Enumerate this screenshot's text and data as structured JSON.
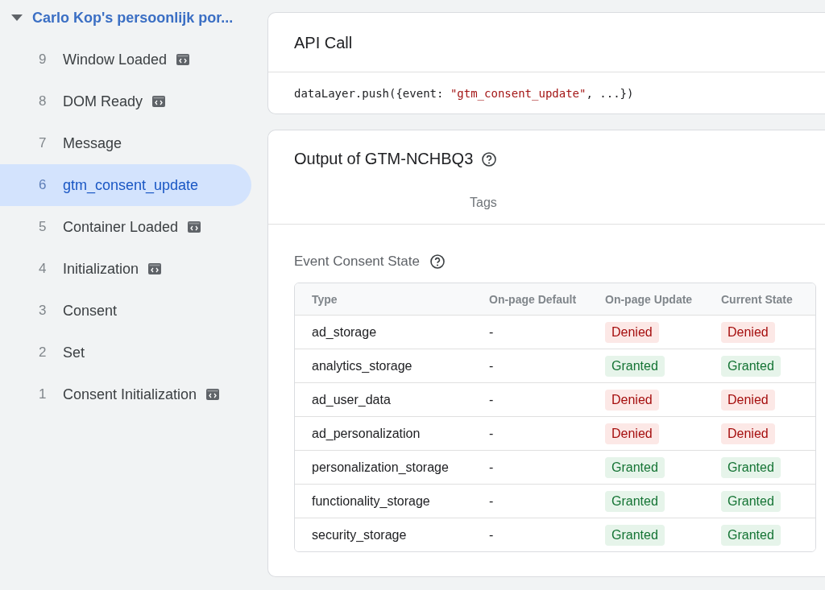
{
  "sidebar": {
    "container": {
      "label": "Carlo Kop's persoonlijk por...",
      "expanded": true
    },
    "items": [
      {
        "number": "9",
        "label": "Window Loaded",
        "has_code_icon": true,
        "selected": false
      },
      {
        "number": "8",
        "label": "DOM Ready",
        "has_code_icon": true,
        "selected": false
      },
      {
        "number": "7",
        "label": "Message",
        "has_code_icon": false,
        "selected": false
      },
      {
        "number": "6",
        "label": "gtm_consent_update",
        "has_code_icon": false,
        "selected": true
      },
      {
        "number": "5",
        "label": "Container Loaded",
        "has_code_icon": true,
        "selected": false
      },
      {
        "number": "4",
        "label": "Initialization",
        "has_code_icon": true,
        "selected": false
      },
      {
        "number": "3",
        "label": "Consent",
        "has_code_icon": false,
        "selected": false
      },
      {
        "number": "2",
        "label": "Set",
        "has_code_icon": false,
        "selected": false
      },
      {
        "number": "1",
        "label": "Consent Initialization",
        "has_code_icon": true,
        "selected": false
      }
    ]
  },
  "api_call": {
    "title": "API Call",
    "code": [
      {
        "kind": "plain",
        "text": "dataLayer.push({event: "
      },
      {
        "kind": "string",
        "text": "\"gtm_consent_update\""
      },
      {
        "kind": "plain",
        "text": ", ...})"
      }
    ]
  },
  "output": {
    "title": "Output of GTM-NCHBQ3",
    "tabs": [
      {
        "label": "Tags",
        "selected": false
      }
    ],
    "consent": {
      "title": "Event Consent State",
      "columns": [
        "Type",
        "On-page Default",
        "On-page Update",
        "Current State"
      ],
      "rows": [
        {
          "type": "ad_storage",
          "default": "-",
          "update": {
            "text": "Denied",
            "kind": "denied"
          },
          "current": {
            "text": "Denied",
            "kind": "denied"
          }
        },
        {
          "type": "analytics_storage",
          "default": "-",
          "update": {
            "text": "Granted",
            "kind": "granted"
          },
          "current": {
            "text": "Granted",
            "kind": "granted"
          }
        },
        {
          "type": "ad_user_data",
          "default": "-",
          "update": {
            "text": "Denied",
            "kind": "denied"
          },
          "current": {
            "text": "Denied",
            "kind": "denied"
          }
        },
        {
          "type": "ad_personalization",
          "default": "-",
          "update": {
            "text": "Denied",
            "kind": "denied"
          },
          "current": {
            "text": "Denied",
            "kind": "denied"
          }
        },
        {
          "type": "personalization_storage",
          "default": "-",
          "update": {
            "text": "Granted",
            "kind": "granted"
          },
          "current": {
            "text": "Granted",
            "kind": "granted"
          }
        },
        {
          "type": "functionality_storage",
          "default": "-",
          "update": {
            "text": "Granted",
            "kind": "granted"
          },
          "current": {
            "text": "Granted",
            "kind": "granted"
          }
        },
        {
          "type": "security_storage",
          "default": "-",
          "update": {
            "text": "Granted",
            "kind": "granted"
          },
          "current": {
            "text": "Granted",
            "kind": "granted"
          }
        }
      ]
    }
  }
}
